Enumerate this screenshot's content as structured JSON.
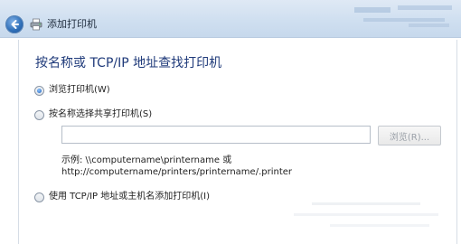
{
  "window": {
    "title": "添加打印机"
  },
  "content": {
    "heading": "按名称或 TCP/IP 地址查找打印机",
    "options": [
      {
        "label": "浏览打印机(W)",
        "selected": true
      },
      {
        "label": "按名称选择共享打印机(S)",
        "selected": false
      },
      {
        "label": "使用 TCP/IP 地址或主机名添加打印机(I)",
        "selected": false
      }
    ],
    "share_input": {
      "value": "",
      "placeholder": ""
    },
    "browse_button": "浏览(R)...",
    "example_line1": "示例: \\\\computername\\printername 或",
    "example_line2": "http://computername/printers/printername/.printer"
  },
  "icons": {
    "back": "back-arrow-icon",
    "printer": "printer-icon"
  },
  "colors": {
    "heading": "#1f3a7a",
    "titlebar": "#cfdff0",
    "back_button": "#2f6fb8"
  }
}
